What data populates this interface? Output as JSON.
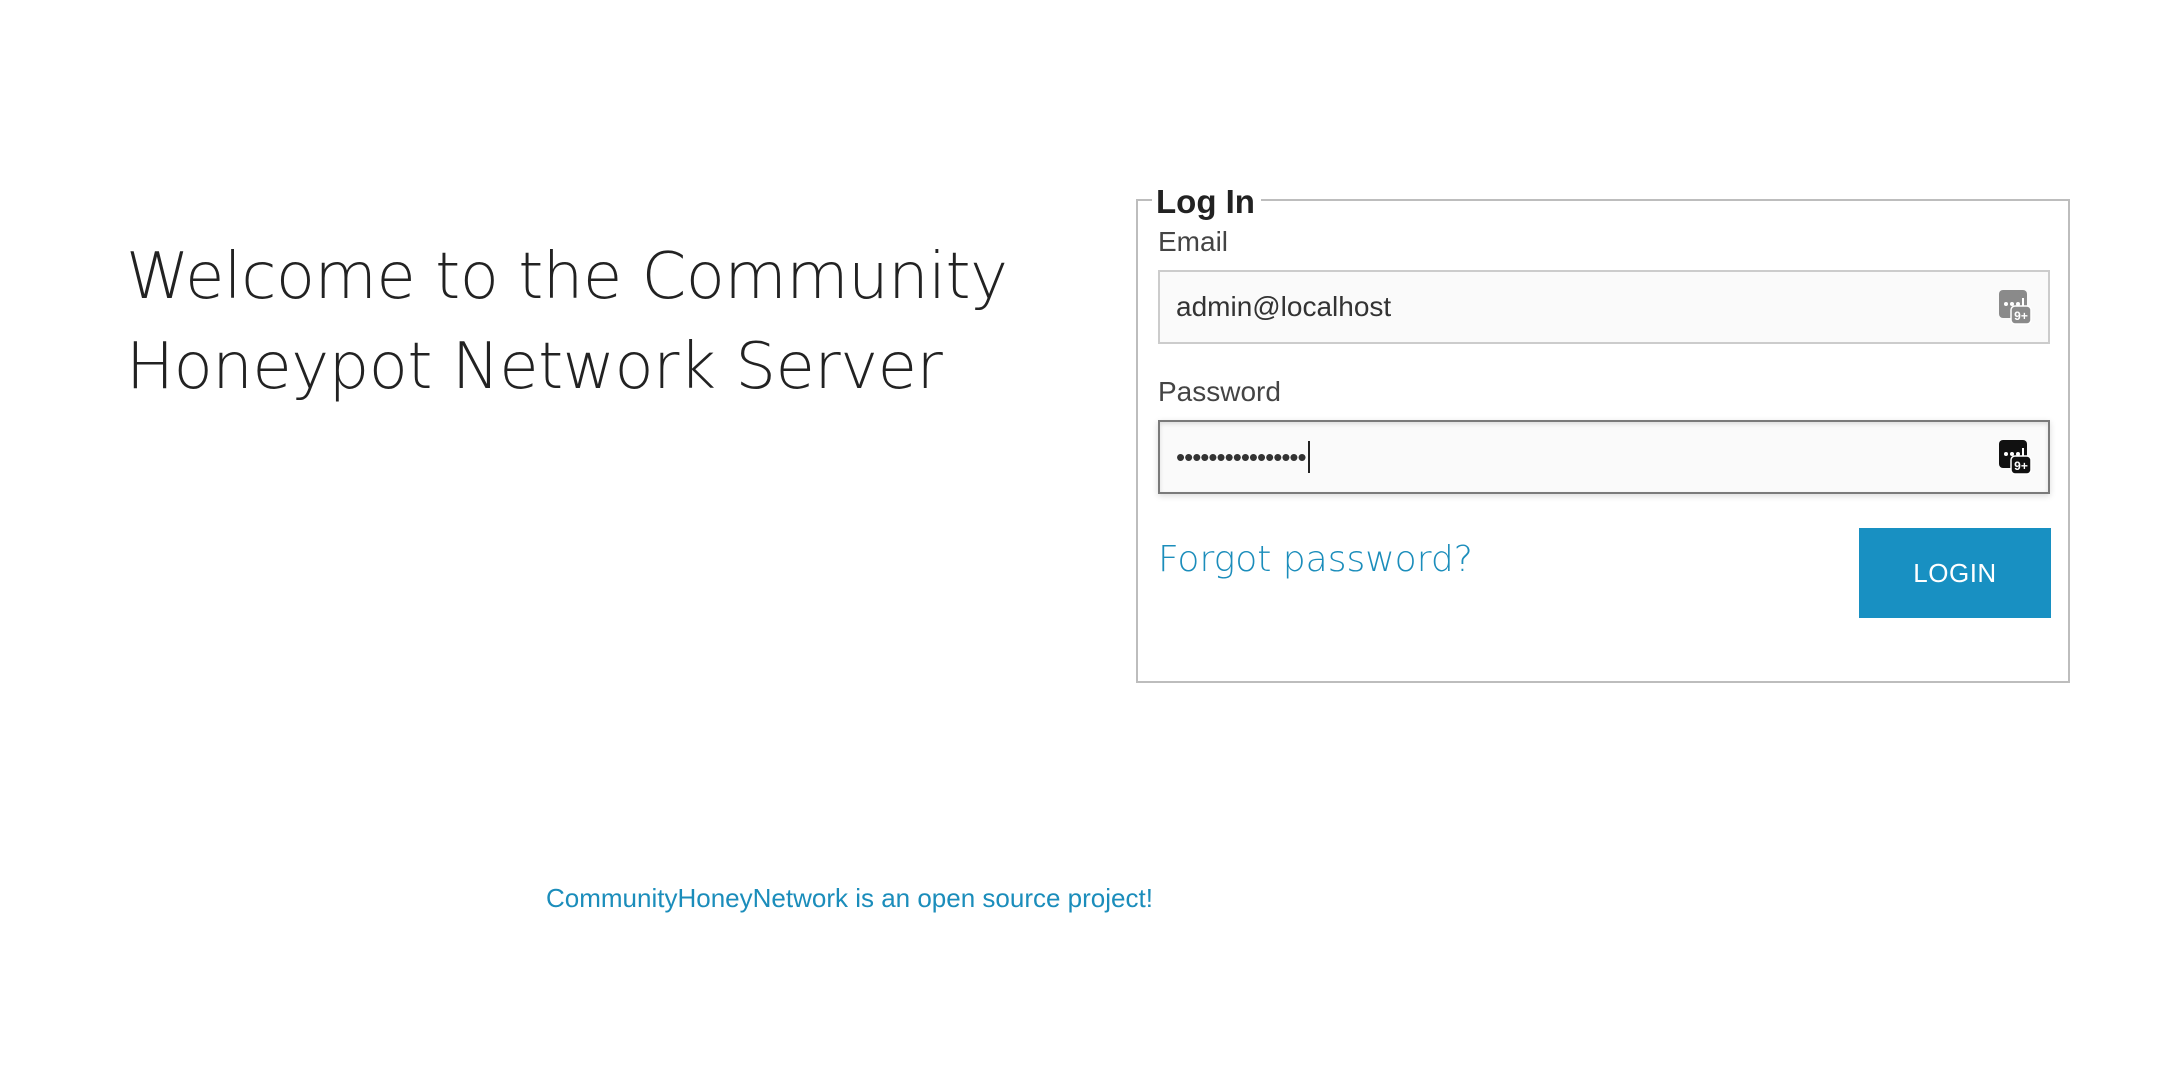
{
  "main": {
    "welcome_line1": "Welcome to the Community",
    "welcome_line2": "Honeypot Network Server"
  },
  "login_form": {
    "legend": "Log In",
    "email_label": "Email",
    "email_value": "admin@localhost",
    "password_label": "Password",
    "password_masked": "••••••••••••••••",
    "forgot_label": "Forgot password?",
    "login_label": "LOGIN"
  },
  "footer": {
    "link_text": "CommunityHoneyNetwork is an open source project!"
  },
  "icons": {
    "password_manager": "password-manager-key-icon"
  },
  "colors": {
    "accent": "#1890c2",
    "link": "#1b8dbb",
    "text": "#222222",
    "border": "#bdbdbd"
  }
}
